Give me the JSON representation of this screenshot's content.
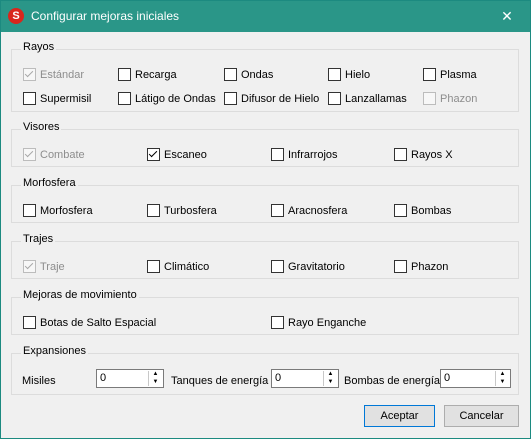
{
  "window": {
    "title": "Configurar mejoras iniciales",
    "close_glyph": "✕",
    "app_icon_glyph": "S"
  },
  "groups": {
    "rayos": {
      "title": "Rayos",
      "items": [
        {
          "label": "Estándar",
          "checked": true,
          "disabled": true
        },
        {
          "label": "Recarga",
          "checked": false,
          "disabled": false
        },
        {
          "label": "Ondas",
          "checked": false,
          "disabled": false
        },
        {
          "label": "Hielo",
          "checked": false,
          "disabled": false
        },
        {
          "label": "Plasma",
          "checked": false,
          "disabled": false
        },
        {
          "label": "Supermisil",
          "checked": false,
          "disabled": false
        },
        {
          "label": "Látigo de Ondas",
          "checked": false,
          "disabled": false
        },
        {
          "label": "Difusor de Hielo",
          "checked": false,
          "disabled": false
        },
        {
          "label": "Lanzallamas",
          "checked": false,
          "disabled": false
        },
        {
          "label": "Phazon",
          "checked": false,
          "disabled": true
        }
      ]
    },
    "visores": {
      "title": "Visores",
      "items": [
        {
          "label": "Combate",
          "checked": true,
          "disabled": true
        },
        {
          "label": "Escaneo",
          "checked": true,
          "disabled": false
        },
        {
          "label": "Infrarrojos",
          "checked": false,
          "disabled": false
        },
        {
          "label": "Rayos X",
          "checked": false,
          "disabled": false
        }
      ]
    },
    "morfosfera": {
      "title": "Morfosfera",
      "items": [
        {
          "label": "Morfosfera",
          "checked": false,
          "disabled": false
        },
        {
          "label": "Turbosfera",
          "checked": false,
          "disabled": false
        },
        {
          "label": "Aracnosfera",
          "checked": false,
          "disabled": false
        },
        {
          "label": "Bombas",
          "checked": false,
          "disabled": false
        }
      ]
    },
    "trajes": {
      "title": "Trajes",
      "items": [
        {
          "label": "Traje",
          "checked": true,
          "disabled": true
        },
        {
          "label": "Climático",
          "checked": false,
          "disabled": false
        },
        {
          "label": "Gravitatorio",
          "checked": false,
          "disabled": false
        },
        {
          "label": "Phazon",
          "checked": false,
          "disabled": false
        }
      ]
    },
    "movimiento": {
      "title": "Mejoras de movimiento",
      "items": [
        {
          "label": "Botas de Salto Espacial",
          "checked": false,
          "disabled": false
        },
        {
          "label": "Rayo Enganche",
          "checked": false,
          "disabled": false
        }
      ]
    },
    "expansiones": {
      "title": "Expansiones",
      "fields": [
        {
          "label": "Misiles",
          "value": "0"
        },
        {
          "label": "Tanques de energía",
          "value": "0"
        },
        {
          "label": "Bombas de energía",
          "value": "0"
        }
      ],
      "spin_up_glyph": "▲",
      "spin_down_glyph": "▼"
    }
  },
  "buttons": {
    "accept": "Aceptar",
    "cancel": "Cancelar"
  }
}
